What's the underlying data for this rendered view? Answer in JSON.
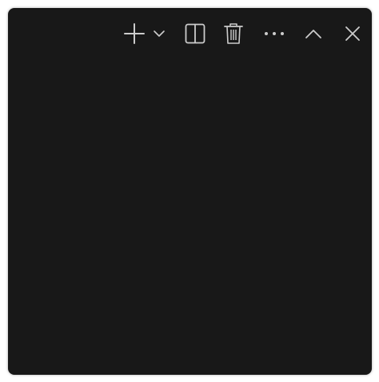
{
  "panel": {
    "background": "#181818",
    "icon_color": "#cccccc"
  },
  "toolbar": {
    "items": [
      {
        "name": "new-terminal",
        "icon": "plus-icon"
      },
      {
        "name": "launch-profile",
        "icon": "chevron-down-icon"
      },
      {
        "name": "split-terminal",
        "icon": "split-panel-icon"
      },
      {
        "name": "kill-terminal",
        "icon": "trash-icon"
      },
      {
        "name": "more-actions",
        "icon": "ellipsis-icon"
      },
      {
        "name": "maximize-panel",
        "icon": "chevron-up-icon"
      },
      {
        "name": "close-panel",
        "icon": "close-icon"
      }
    ]
  }
}
